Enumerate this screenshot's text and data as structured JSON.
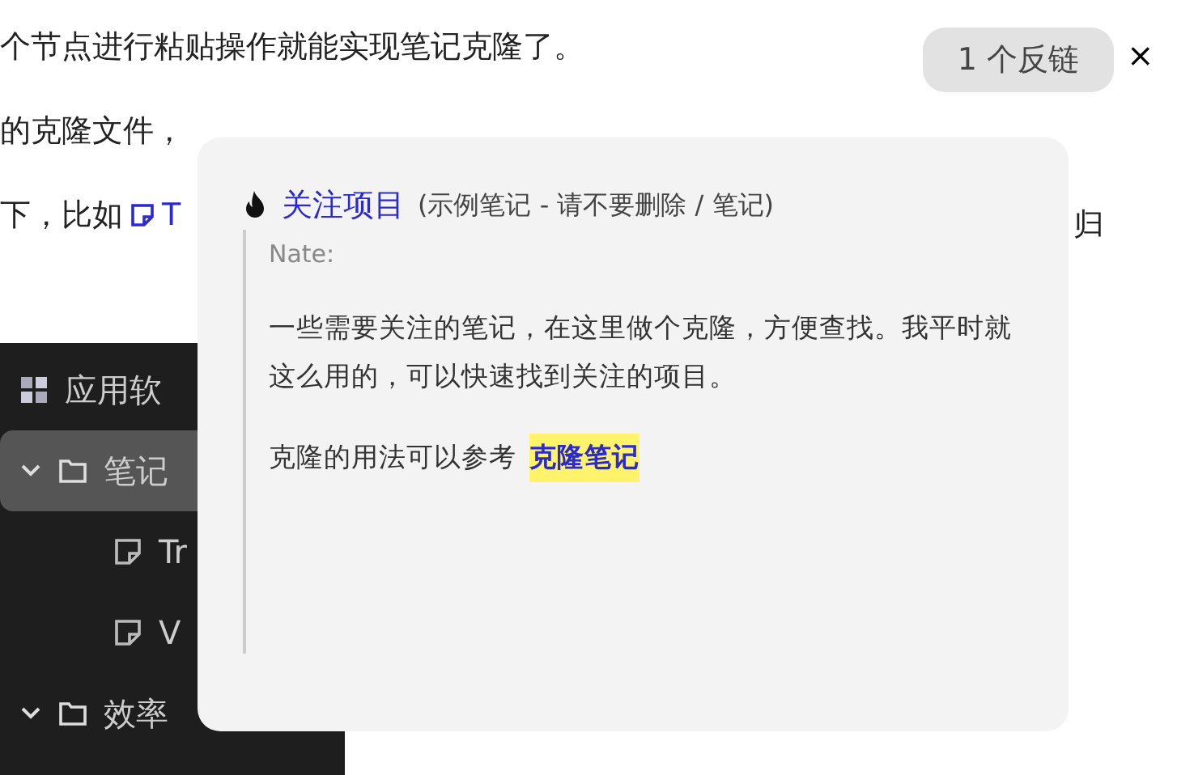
{
  "document": {
    "line_1": "个节点进行粘贴操作就能实现笔记克隆了。",
    "line_2": "的克隆文件，",
    "line_3": {
      "before": "下，比如",
      "link": "T",
      "trailing": "归"
    }
  },
  "backlinks_button": {
    "label": "1 个反链"
  },
  "close_button": {
    "label": "×"
  },
  "embedded_sidebar": {
    "items": [
      {
        "kind": "app",
        "label": "应用软",
        "selected": false
      },
      {
        "kind": "folder",
        "label": "笔记",
        "expanded": true,
        "selected": true,
        "children": [
          {
            "kind": "note",
            "label": "Tr",
            "selected": false
          },
          {
            "kind": "note",
            "label": "V",
            "selected": false
          }
        ]
      },
      {
        "kind": "folder",
        "label": "效率",
        "expanded": true,
        "selected": false
      }
    ]
  },
  "popup": {
    "title": "关注项目",
    "path": "(示例笔记 - 请不要删除 / 笔记)",
    "author": "Nate:",
    "paragraph": "一些需要关注的笔记，在这里做个克隆，方便查找。我平时就这么用的，可以快速找到关注的项目。",
    "reference": {
      "text": "克隆的用法可以参考",
      "link": "克隆笔记"
    }
  }
}
